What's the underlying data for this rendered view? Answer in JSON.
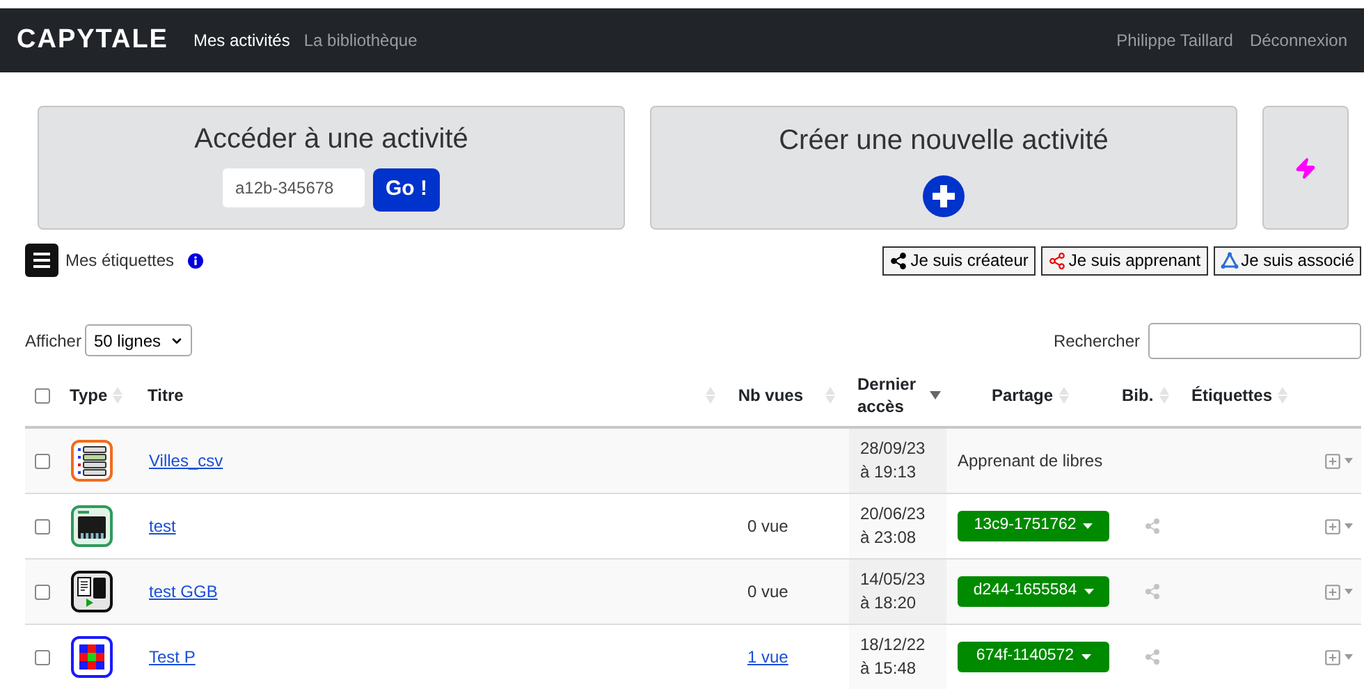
{
  "navbar": {
    "brand": "CAPYTALE",
    "links": [
      {
        "label": "Mes activités",
        "selected": true
      },
      {
        "label": "La bibliothèque",
        "selected": false
      }
    ],
    "user": "Philippe Taillard",
    "logout": "Déconnexion"
  },
  "access_card": {
    "title": "Accéder à une activité",
    "code_field": {
      "placeholder": "a12b-345678"
    },
    "go_button": "Go !"
  },
  "create_card": {
    "title": "Créer une nouvelle activité"
  },
  "tags": {
    "label": "Mes étiquettes"
  },
  "role_filters": [
    {
      "label": "Je suis créateur",
      "kind": "creator"
    },
    {
      "label": "Je suis apprenant",
      "kind": "learner"
    },
    {
      "label": "Je suis associé",
      "kind": "associate"
    }
  ],
  "page_size": {
    "label": "Afficher",
    "value": "50 lignes"
  },
  "search": {
    "label": "Rechercher"
  },
  "table": {
    "header_checked": false,
    "columns": [
      {
        "label": "Type",
        "sorted": false
      },
      {
        "label": "Titre",
        "sorted": false
      },
      {
        "label": "Nb vues",
        "sorted": false
      },
      {
        "label": "Dernier accès",
        "sorted": true
      },
      {
        "label": "Partage",
        "sorted": false
      },
      {
        "label": "Bib.",
        "sorted": false
      },
      {
        "label": "Étiquettes",
        "sorted": false
      }
    ],
    "rows": [
      {
        "checked": false,
        "kind": "csv",
        "title": "Villes_csv",
        "date": "28/09/23",
        "time": "à 19:13",
        "share": {
          "kind": "text",
          "label": "Apprenant de libres"
        },
        "bib_icon": false
      },
      {
        "checked": false,
        "kind": "microbit",
        "title": "test",
        "views": "0 vue",
        "views_link": false,
        "date": "20/06/23",
        "time": "à 23:08",
        "share": {
          "kind": "code",
          "label": "13c9-1751762"
        },
        "bib_icon": true
      },
      {
        "checked": false,
        "kind": "geogebra",
        "title": "test GGB",
        "views": "0 vue",
        "views_link": false,
        "date": "14/05/23",
        "time": "à 18:20",
        "share": {
          "kind": "code",
          "label": "d244-1655584"
        },
        "bib_icon": true
      },
      {
        "checked": false,
        "kind": "pixel",
        "title": "Test P",
        "views": "1 vue",
        "views_link": true,
        "date": "18/12/22",
        "time": "à 15:48",
        "share": {
          "kind": "code",
          "label": "674f-1140572"
        },
        "bib_icon": true
      }
    ]
  }
}
